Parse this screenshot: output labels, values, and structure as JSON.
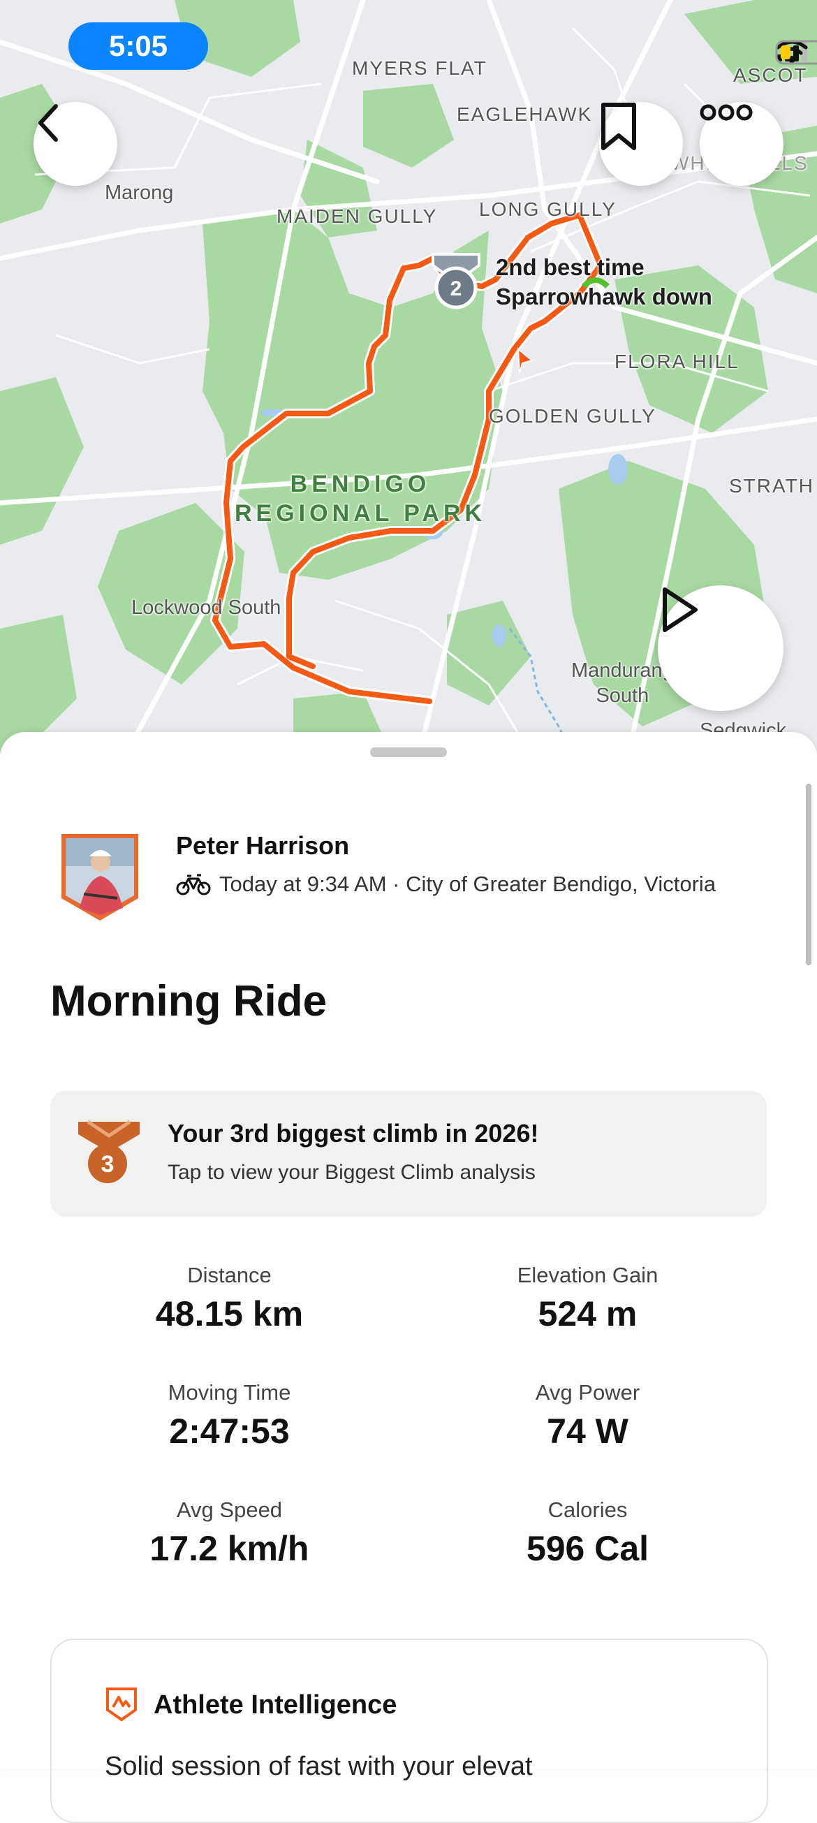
{
  "status_bar": {
    "time": "5:05"
  },
  "map": {
    "labels": {
      "myers_flat": "MYERS FLAT",
      "ascot": "ASCOT",
      "eaglehawk": "EAGLEHAWK",
      "marong": "Marong",
      "maiden_gully": "MAIDEN GULLY",
      "long_gully": "LONG GULLY",
      "flora_hill": "FLORA HILL",
      "golden_gully": "GOLDEN GULLY",
      "strath": "STRATH",
      "park_line1": "BENDIGO",
      "park_line2": "REGIONAL PARK",
      "lockwood_south": "Lockwood South",
      "mandurang_line1": "Mandurang",
      "mandurang_line2": "South",
      "sedgwick": "Sedgwick",
      "white_hills": "WHITE HILLS"
    },
    "achievement": {
      "line1": "2nd best time",
      "line2": "Sparrowhawk down",
      "medal_rank": "2"
    },
    "buttons": [
      "back",
      "bookmark",
      "more",
      "play"
    ]
  },
  "athlete": {
    "name": "Peter Harrison",
    "meta": "Today at 9:34 AM · City of Greater Bendigo, Victoria",
    "sport_icon": "bike-icon"
  },
  "activity": {
    "title": "Morning Ride"
  },
  "achievement_card": {
    "rank": "3",
    "title": "Your 3rd biggest climb in 2026!",
    "subtitle": "Tap to view your Biggest Climb analysis"
  },
  "stats": [
    {
      "label": "Distance",
      "value": "48.15 km"
    },
    {
      "label": "Elevation Gain",
      "value": "524 m"
    },
    {
      "label": "Moving Time",
      "value": "2:47:53"
    },
    {
      "label": "Avg Power",
      "value": "74 W"
    },
    {
      "label": "Avg Speed",
      "value": "17.2 km/h"
    },
    {
      "label": "Calories",
      "value": "596 Cal"
    }
  ],
  "athlete_intelligence": {
    "title": "Athlete Intelligence",
    "body": "Solid session of fast with your elevat"
  },
  "colors": {
    "route": "#f45a14",
    "map_green": "#a8d8a2",
    "status_pill": "#0a84ff",
    "medal_bronze": "#c8632a"
  }
}
